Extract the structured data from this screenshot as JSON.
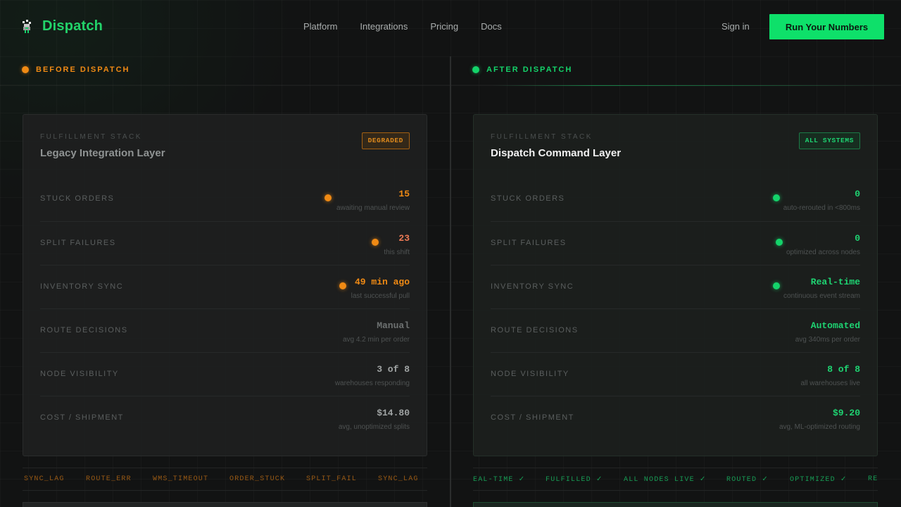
{
  "brand": {
    "name": "Dispatch"
  },
  "nav": {
    "links": [
      "Platform",
      "Integrations",
      "Pricing",
      "Docs"
    ],
    "sign_in": "Sign in",
    "cta": "Run Your Numbers"
  },
  "before": {
    "heading": "BEFORE DISPATCH",
    "eyebrow": "FULFILLMENT STACK",
    "title": "Legacy Integration Layer",
    "badge": "DEGRADED",
    "rows": [
      {
        "label": "STUCK ORDERS",
        "value": "15",
        "sub": "awaiting manual review"
      },
      {
        "label": "SPLIT FAILURES",
        "value": "23",
        "sub": "this shift"
      },
      {
        "label": "INVENTORY SYNC",
        "value": "49 min ago",
        "sub": "last successful pull"
      },
      {
        "label": "ROUTE DECISIONS",
        "value": "Manual",
        "sub": "avg 4.2 min per order"
      },
      {
        "label": "NODE VISIBILITY",
        "value": "3 of 8",
        "sub": "warehouses responding"
      },
      {
        "label": "COST / SHIPMENT",
        "value": "$14.80",
        "sub": "avg, unoptimized splits"
      }
    ],
    "ticker": [
      "SYNC_LAG",
      "ROUTE_ERR",
      "WMS_TIMEOUT",
      "ORDER_STUCK",
      "SPLIT_FAIL",
      "SYNC_LAG"
    ]
  },
  "after": {
    "heading": "AFTER DISPATCH",
    "eyebrow": "FULFILLMENT STACK",
    "title": "Dispatch Command Layer",
    "badge": "ALL SYSTEMS",
    "rows": [
      {
        "label": "STUCK ORDERS",
        "value": "0",
        "sub": "auto-rerouted in <800ms"
      },
      {
        "label": "SPLIT FAILURES",
        "value": "0",
        "sub": "optimized across nodes"
      },
      {
        "label": "INVENTORY SYNC",
        "value": "Real-time",
        "sub": "continuous event stream"
      },
      {
        "label": "ROUTE DECISIONS",
        "value": "Automated",
        "sub": "avg 340ms per order"
      },
      {
        "label": "NODE VISIBILITY",
        "value": "8 of 8",
        "sub": "all warehouses live"
      },
      {
        "label": "COST / SHIPMENT",
        "value": "$9.20",
        "sub": "avg, ML-optimized routing"
      }
    ],
    "ticker": [
      "EAL-TIME ✓",
      "FULFILLED ✓",
      "ALL NODES LIVE ✓",
      "ROUTED ✓",
      "OPTIMIZED ✓",
      "REA"
    ]
  },
  "colors": {
    "accent_green": "#14d36a",
    "accent_orange": "#f08a14",
    "background": "#121313"
  },
  "icons": {
    "logo": "dispatch-logo-icon"
  }
}
